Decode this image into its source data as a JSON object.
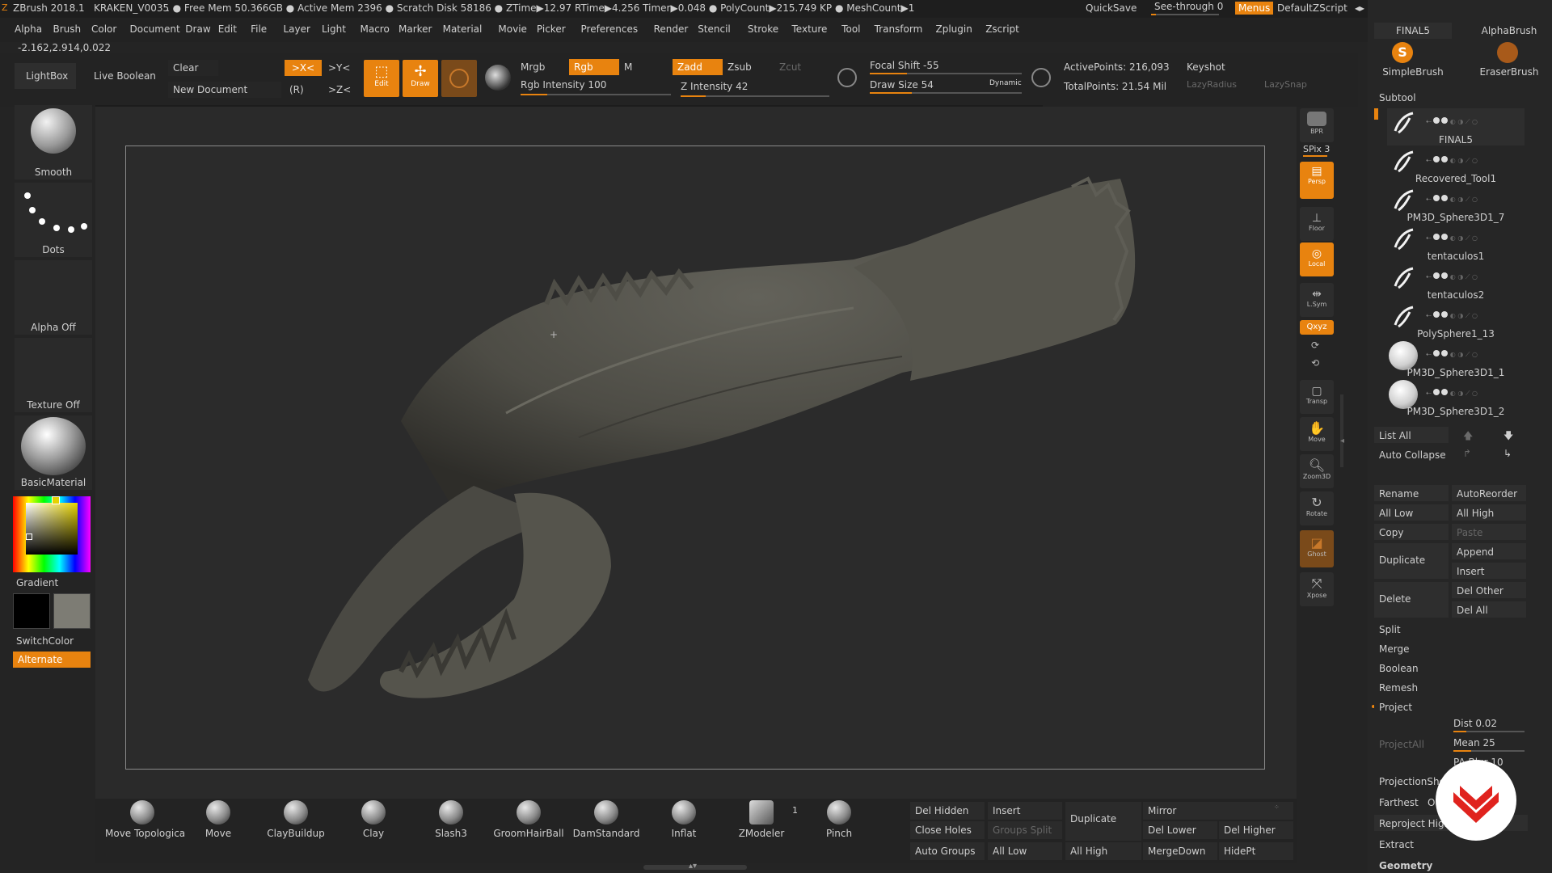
{
  "titlebar": {
    "app": "ZBrush 2018.1",
    "document": "KRAKEN_V0035",
    "status": ". ● Free Mem 50.366GB ● Active Mem 2396 ● Scratch Disk 58186 ● ZTime▶12.97 RTime▶4.256 Timer▶0.048 ● PolyCount▶215.749 KP ● MeshCount▶1",
    "quicksave": "QuickSave",
    "seethrough": "See-through",
    "seethrough_value": "0",
    "menus": "Menus",
    "script": "DefaultZScript"
  },
  "menubar": {
    "items": [
      "Alpha",
      "Brush",
      "Color",
      "Document",
      "Draw",
      "Edit",
      "File",
      "Layer",
      "Light",
      "Macro",
      "Marker",
      "Material",
      "Movie",
      "Picker",
      "Preferences",
      "Render",
      "Stencil",
      "Stroke",
      "Texture",
      "Tool",
      "Transform",
      "Zplugin",
      "Zscript"
    ]
  },
  "coords": "-2.162,2.914,0.022",
  "toolbar": {
    "lightbox": "LightBox",
    "live_boolean": "Live Boolean",
    "clear": "Clear",
    "new_document": "New Document",
    "sym_x": ">X<",
    "sym_y": ">Y<",
    "sym_z": ">Z<",
    "sym_r": "(R)",
    "edit": "Edit",
    "draw": "Draw",
    "mrgb": "Mrgb",
    "rgb": "Rgb",
    "m": "M",
    "rgb_intensity": "Rgb Intensity 100",
    "zadd": "Zadd",
    "zsub": "Zsub",
    "zcut": "Zcut",
    "z_intensity": "Z Intensity 42",
    "focal_shift": "Focal Shift -55",
    "draw_size": "Draw Size 54",
    "dynamic": "Dynamic",
    "active_points": "ActivePoints: 216,093",
    "total_points": "TotalPoints: 21.54 Mil",
    "keyshot": "Keyshot",
    "lazy_radius": "LazyRadius",
    "lazy_snap": "LazySnap",
    "rgb_intensity_fraction": 1.0,
    "z_intensity_fraction": 0.42
  },
  "left_shelf": {
    "smooth": "Smooth",
    "dots": "Dots",
    "alpha_off": "Alpha Off",
    "texture_off": "Texture Off",
    "material": "BasicMaterial",
    "gradient": "Gradient",
    "switch_color": "SwitchColor",
    "alternate": "Alternate"
  },
  "right_tools": {
    "bpr": "BPR",
    "spix": "SPix 3",
    "persp": "Persp",
    "floor": "Floor",
    "local": "Local",
    "lsym": "L.Sym",
    "xyz": "Qxyz",
    "transp": "Transp",
    "move": "Move",
    "zoom3d": "Zoom3D",
    "rotate": "Rotate",
    "ghost": "Ghost",
    "xpose": "Xpose"
  },
  "right_panel": {
    "top_items": [
      "FINAL5",
      "AlphaBrush",
      "SimpleBrush",
      "EraserBrush"
    ],
    "subtool_header": "Subtool",
    "subtools": [
      "FINAL5",
      "Recovered_Tool1",
      "PM3D_Sphere3D1_7",
      "tentaculos1",
      "tentaculos2",
      "PolySphere1_13",
      "PM3D_Sphere3D1_1",
      "PM3D_Sphere3D1_2"
    ],
    "list_all": "List All",
    "auto_collapse": "Auto Collapse",
    "rename": "Rename",
    "auto_reorder": "AutoReorder",
    "all_low": "All Low",
    "all_high": "All High",
    "copy": "Copy",
    "paste": "Paste",
    "duplicate": "Duplicate",
    "append": "Append",
    "insert": "Insert",
    "delete": "Delete",
    "del_other": "Del Other",
    "del_all": "Del All",
    "split": "Split",
    "merge": "Merge",
    "boolean": "Boolean",
    "remesh": "Remesh",
    "project": "Project",
    "dist": "Dist 0.02",
    "mean": "Mean 25",
    "pa_blur": "PA Blur 10",
    "project_all": "ProjectAll",
    "projection_shell": "ProjectionShell",
    "farthest": "Farthest",
    "outer": "Outer",
    "reproject_higher": "Reproject Higher",
    "extract": "Extract",
    "geometry": "Geometry"
  },
  "brushes": [
    "Move Topologica",
    "Move",
    "ClayBuildup",
    "Clay",
    "Slash3",
    "GroomHairBall",
    "DamStandard",
    "Inflat",
    "ZModeler",
    "Pinch"
  ],
  "zmodeler_count": "1",
  "bottom_buttons": {
    "del_hidden": "Del Hidden",
    "insert": "Insert",
    "duplicate": "Duplicate",
    "mirror": "Mirror",
    "close_holes": "Close Holes",
    "groups_split": "Groups Split",
    "del_lower": "Del Lower",
    "del_higher": "Del Higher",
    "auto_groups": "Auto Groups",
    "all_low": "All Low",
    "all_high": "All High",
    "merge_down": "MergeDown",
    "hide_pt": "HidePt"
  },
  "colors": {
    "accent": "#e8830f",
    "background": "#242424",
    "panel": "#262626",
    "canvas": "#2b2b2b",
    "mesh": "#4e4d46",
    "badge": "#e0231e"
  }
}
